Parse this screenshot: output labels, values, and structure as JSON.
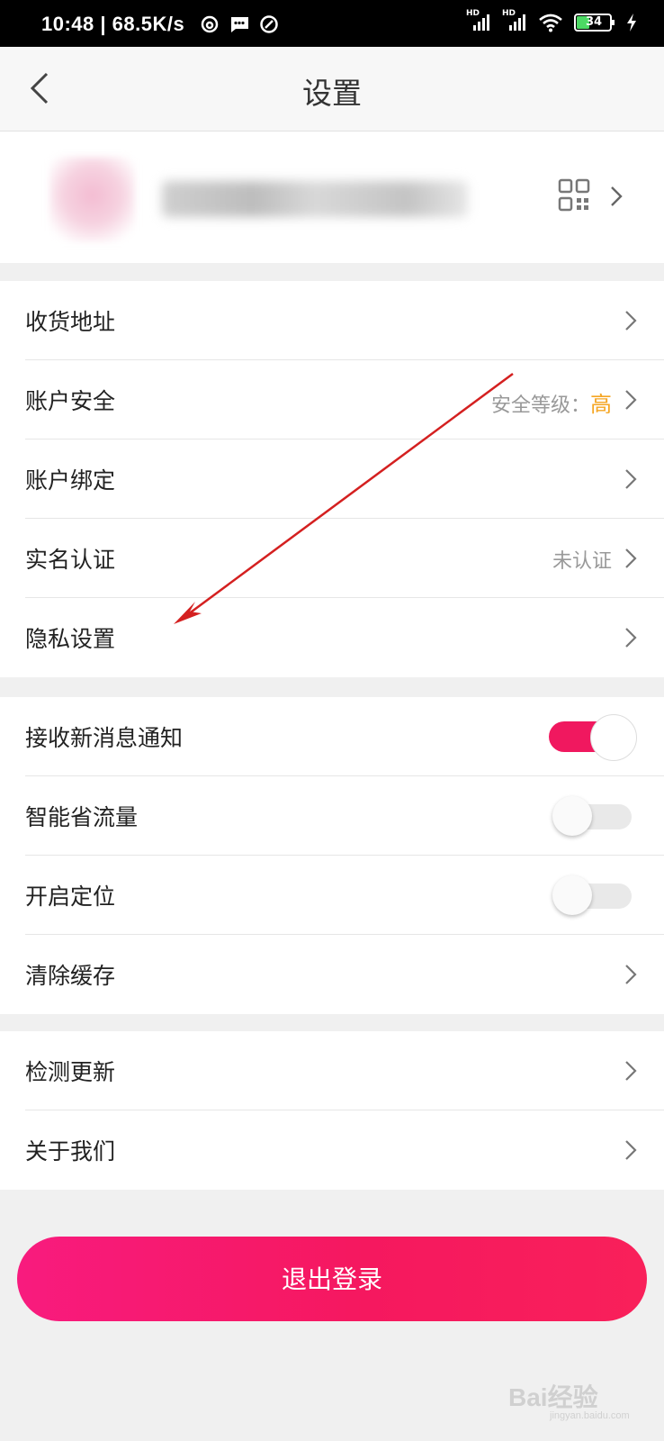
{
  "status_bar": {
    "time": "10:48",
    "speed": "68.5K/s",
    "network_1": "HD",
    "network_2": "HD",
    "battery": "34"
  },
  "nav": {
    "title": "设置"
  },
  "sections": {
    "account": [
      {
        "label": "收货地址"
      },
      {
        "label": "账户安全",
        "value_prefix": "安全等级：",
        "value_level": "高"
      },
      {
        "label": "账户绑定"
      },
      {
        "label": "实名认证",
        "value": "未认证"
      },
      {
        "label": "隐私设置"
      }
    ],
    "prefs": [
      {
        "label": "接收新消息通知",
        "toggle": true
      },
      {
        "label": "智能省流量",
        "toggle": false
      },
      {
        "label": "开启定位",
        "toggle": false
      },
      {
        "label": "清除缓存"
      }
    ],
    "about": [
      {
        "label": "检测更新"
      },
      {
        "label": "关于我们"
      }
    ]
  },
  "logout_label": "退出登录",
  "watermark": {
    "brand": "Bai经验",
    "url": "jingyan.baidu.com"
  },
  "colors": {
    "accent": "#f5185f",
    "level_high": "#f5a623",
    "annotation_arrow": "#d42020"
  }
}
